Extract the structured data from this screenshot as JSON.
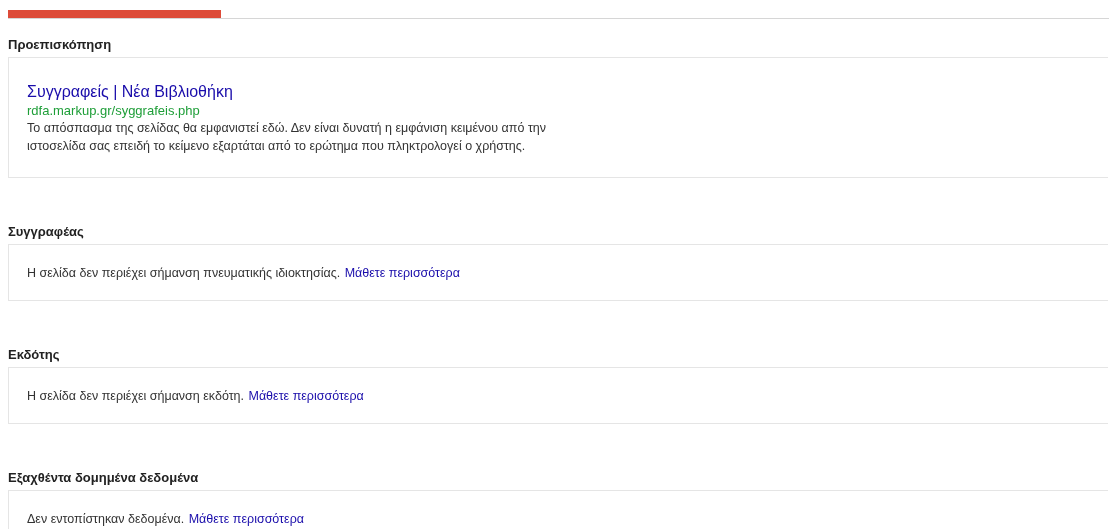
{
  "tabs": [
    {
      "selected": true
    }
  ],
  "sections": [
    {
      "heading": "Προεπισκόπηση",
      "kind": "preview",
      "title": "Συγγραφείς | Νέα Βιβλιοθήκη",
      "url": "rdfa.markup.gr/syggrafeis.php",
      "snippet": "Το απόσπασμα της σελίδας θα εμφανιστεί εδώ. Δεν είναι δυνατή η εμφάνιση κειμένου από την ιστοσελίδα σας επειδή το κείμενο εξαρτάται από το ερώτημα που πληκτρολογεί ο χρήστης."
    },
    {
      "heading": "Συγγραφέας",
      "kind": "message",
      "message": "Η σελίδα δεν περιέχει σήμανση πνευματικής ιδιοκτησίας.",
      "link": "Μάθετε περισσότερα"
    },
    {
      "heading": "Εκδότης",
      "kind": "message",
      "message": "Η σελίδα δεν περιέχει σήμανση εκδότη.",
      "link": "Μάθετε περισσότερα"
    },
    {
      "heading": "Εξαχθέντα δομημένα δεδομένα",
      "kind": "message",
      "message": "Δεν εντοπίστηκαν δεδομένα.",
      "link": "Μάθετε περισσότερα"
    }
  ]
}
